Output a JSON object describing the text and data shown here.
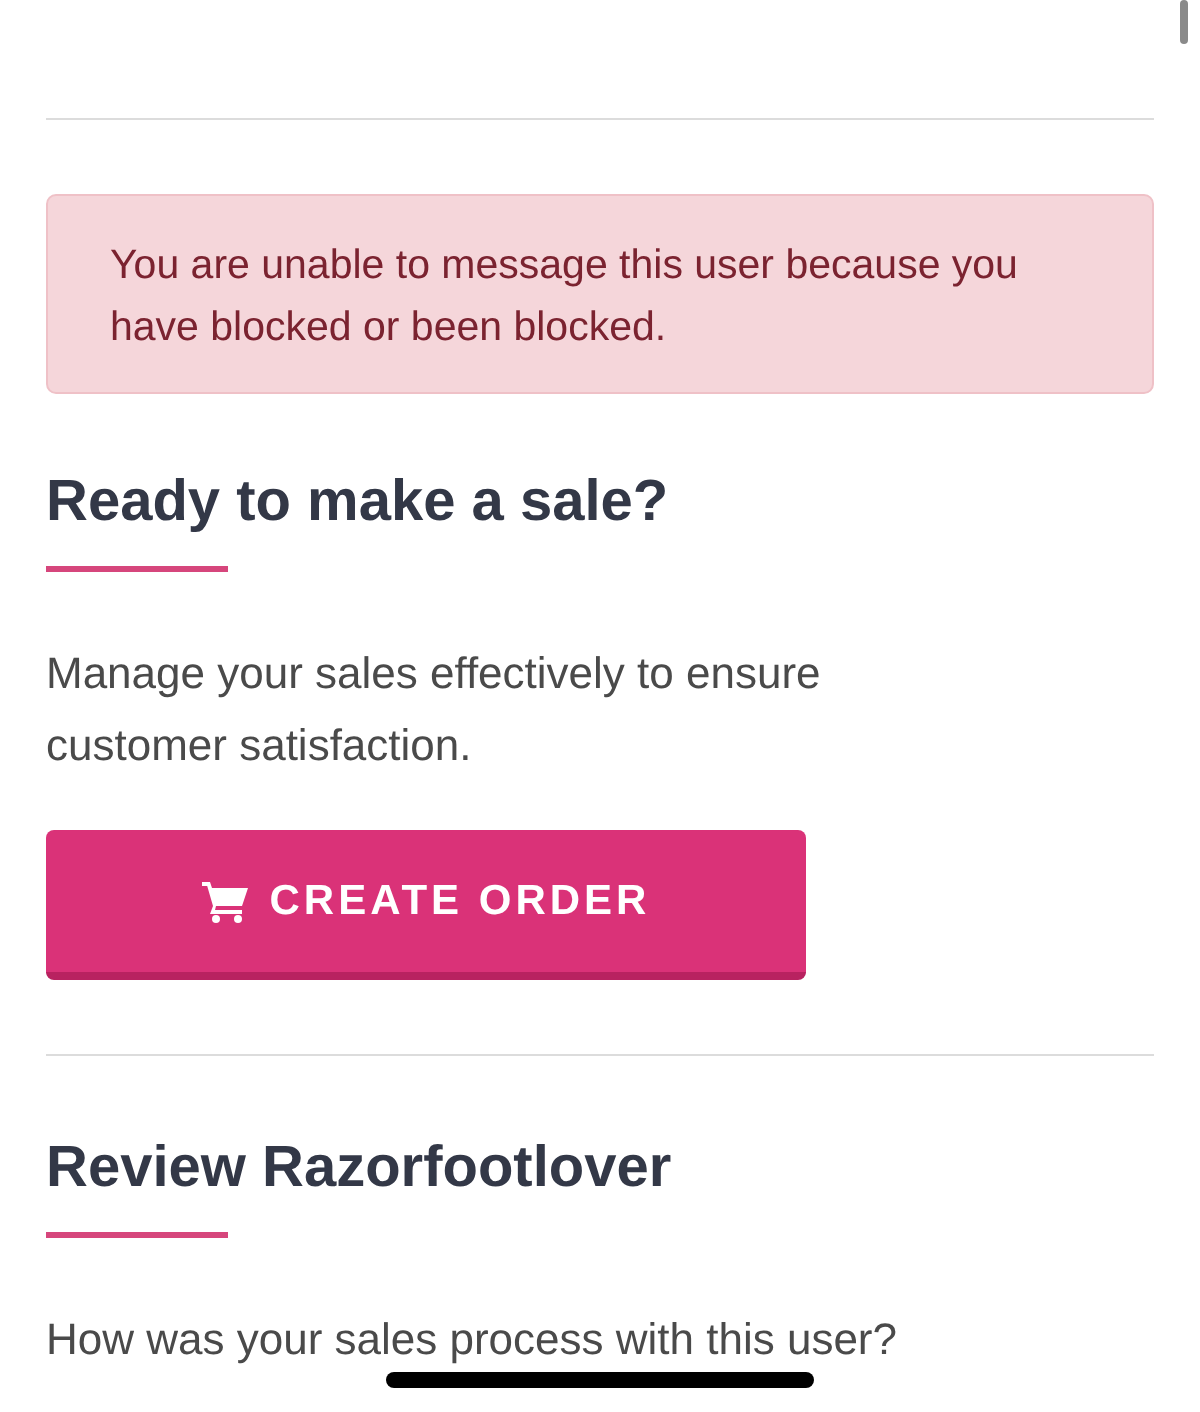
{
  "alert": {
    "text": "You are unable to message this user because you have blocked or been blocked."
  },
  "sections": [
    {
      "heading": "Ready to make a sale?",
      "text": "Manage your sales effectively to ensure customer satisfaction.",
      "button": "CREATE ORDER"
    },
    {
      "heading": "Review Razorfootlover",
      "text": "How was your sales process with this user?"
    }
  ]
}
